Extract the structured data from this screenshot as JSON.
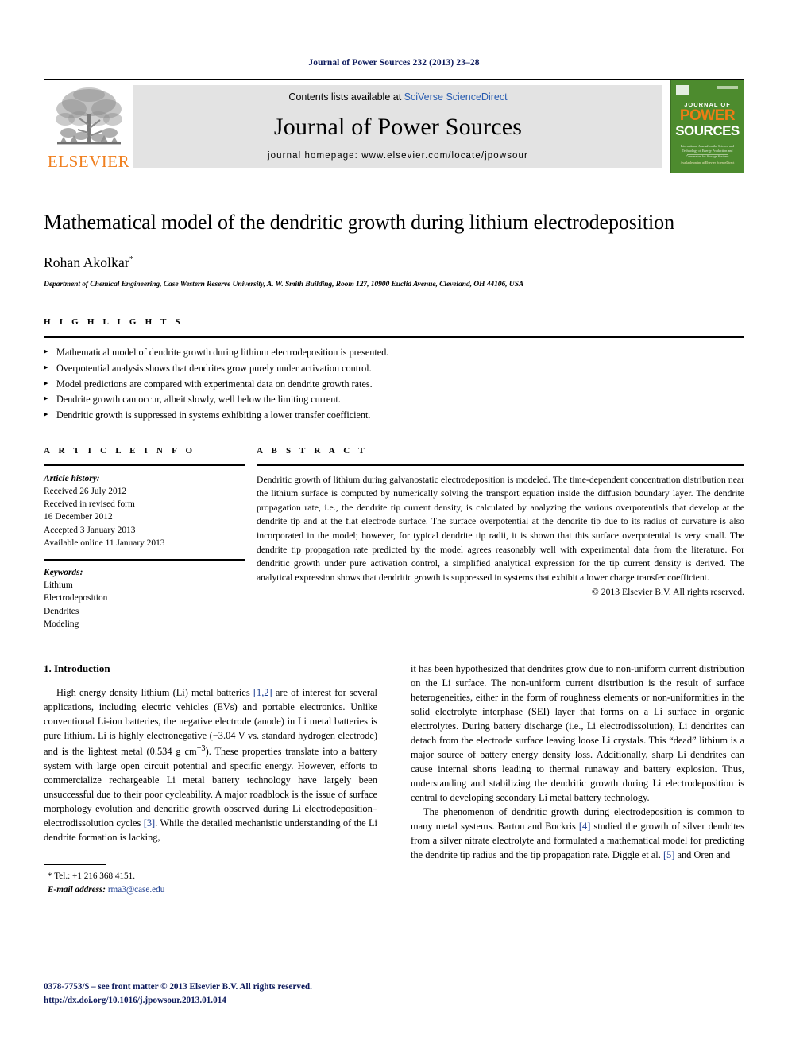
{
  "running_head": "Journal of Power Sources 232 (2013) 23–28",
  "masthead": {
    "publisher": "ELSEVIER",
    "contents_prefix": "Contents lists available at ",
    "contents_link": "SciVerse ScienceDirect",
    "journal_title": "Journal of Power Sources",
    "homepage": "journal homepage: www.elsevier.com/locate/jpowsour",
    "cover": {
      "line1": "JOURNAL OF",
      "line2": "POWER",
      "line3": "SOURCES",
      "subtitle": "International Journal on the Science and Technology of Energy Production and Conversion for Storage Systems",
      "footer": "Available online at Elsevier ScienceDirect",
      "green": "#4d8b2e",
      "orange": "#f07c14"
    }
  },
  "article": {
    "title": "Mathematical model of the dendritic growth during lithium electrodeposition",
    "author": "Rohan Akolkar",
    "author_marker": "*",
    "affiliation": "Department of Chemical Engineering, Case Western Reserve University, A. W. Smith Building, Room 127, 10900 Euclid Avenue, Cleveland, OH 44106, USA"
  },
  "highlights": {
    "label": "H I G H L I G H T S",
    "items": [
      "Mathematical model of dendrite growth during lithium electrodeposition is presented.",
      "Overpotential analysis shows that dendrites grow purely under activation control.",
      "Model predictions are compared with experimental data on dendrite growth rates.",
      "Dendrite growth can occur, albeit slowly, well below the limiting current.",
      "Dendritic growth is suppressed in systems exhibiting a lower transfer coefficient."
    ]
  },
  "article_info": {
    "label": "A R T I C L E   I N F O",
    "history_label": "Article history:",
    "history": [
      "Received 26 July 2012",
      "Received in revised form",
      "16 December 2012",
      "Accepted 3 January 2013",
      "Available online 11 January 2013"
    ],
    "keywords_label": "Keywords:",
    "keywords": [
      "Lithium",
      "Electrodeposition",
      "Dendrites",
      "Modeling"
    ]
  },
  "abstract": {
    "label": "A B S T R A C T",
    "text": "Dendritic growth of lithium during galvanostatic electrodeposition is modeled. The time-dependent concentration distribution near the lithium surface is computed by numerically solving the transport equation inside the diffusion boundary layer. The dendrite propagation rate, i.e., the dendrite tip current density, is calculated by analyzing the various overpotentials that develop at the dendrite tip and at the flat electrode surface. The surface overpotential at the dendrite tip due to its radius of curvature is also incorporated in the model; however, for typical dendrite tip radii, it is shown that this surface overpotential is very small. The dendrite tip propagation rate predicted by the model agrees reasonably well with experimental data from the literature. For dendritic growth under pure activation control, a simplified analytical expression for the tip current density is derived. The analytical expression shows that dendritic growth is suppressed in systems that exhibit a lower charge transfer coefficient.",
    "copyright": "© 2013 Elsevier B.V. All rights reserved."
  },
  "introduction": {
    "heading": "1. Introduction",
    "left_paragraph_parts": {
      "p1a": "High energy density lithium (Li) metal batteries ",
      "p1_ref1": "[1,2]",
      "p1b": " are of interest for several applications, including electric vehicles (EVs) and portable electronics. Unlike conventional Li-ion batteries, the negative electrode (anode) in Li metal batteries is pure lithium. Li is highly electronegative (−3.04 V vs. standard hydrogen electrode) and is the lightest metal (0.534 g cm",
      "p1_sup": "−3",
      "p1c": "). These properties translate into a battery system with large open circuit potential and specific energy. However, efforts to commercialize rechargeable Li metal battery technology have largely been unsuccessful due to their poor cycleability. A major roadblock is the issue of surface morphology evolution and dendritic growth observed during Li electrodeposition–electrodissolution cycles ",
      "p1_ref2": "[3]",
      "p1d": ". While the detailed mechanistic understanding of the Li dendrite formation is lacking,"
    },
    "right_paragraph_1": "it has been hypothesized that dendrites grow due to non-uniform current distribution on the Li surface. The non-uniform current distribution is the result of surface heterogeneities, either in the form of roughness elements or non-uniformities in the solid electrolyte interphase (SEI) layer that forms on a Li surface in organic electrolytes. During battery discharge (i.e., Li electrodissolution), Li dendrites can detach from the electrode surface leaving loose Li crystals. This “dead” lithium is a major source of battery energy density loss. Additionally, sharp Li dendrites can cause internal shorts leading to thermal runaway and battery explosion. Thus, understanding and stabilizing the dendritic growth during Li electrodeposition is central to developing secondary Li metal battery technology.",
    "right_paragraph_2_parts": {
      "a": "The phenomenon of dendritic growth during electrodeposition is common to many metal systems. Barton and Bockris ",
      "ref1": "[4]",
      "b": " studied the growth of silver dendrites from a silver nitrate electrolyte and formulated a mathematical model for predicting the dendrite tip radius and the tip propagation rate. Diggle et al. ",
      "ref2": "[5]",
      "c": " and Oren and"
    }
  },
  "footnote": {
    "tel": "* Tel.: +1 216 368 4151.",
    "email_label": "E-mail address:",
    "email": "rma3@case.edu"
  },
  "page_footer": {
    "issn_line": "0378-7753/$ – see front matter © 2013 Elsevier B.V. All rights reserved.",
    "doi": "http://dx.doi.org/10.1016/j.jpowsour.2013.01.014"
  }
}
